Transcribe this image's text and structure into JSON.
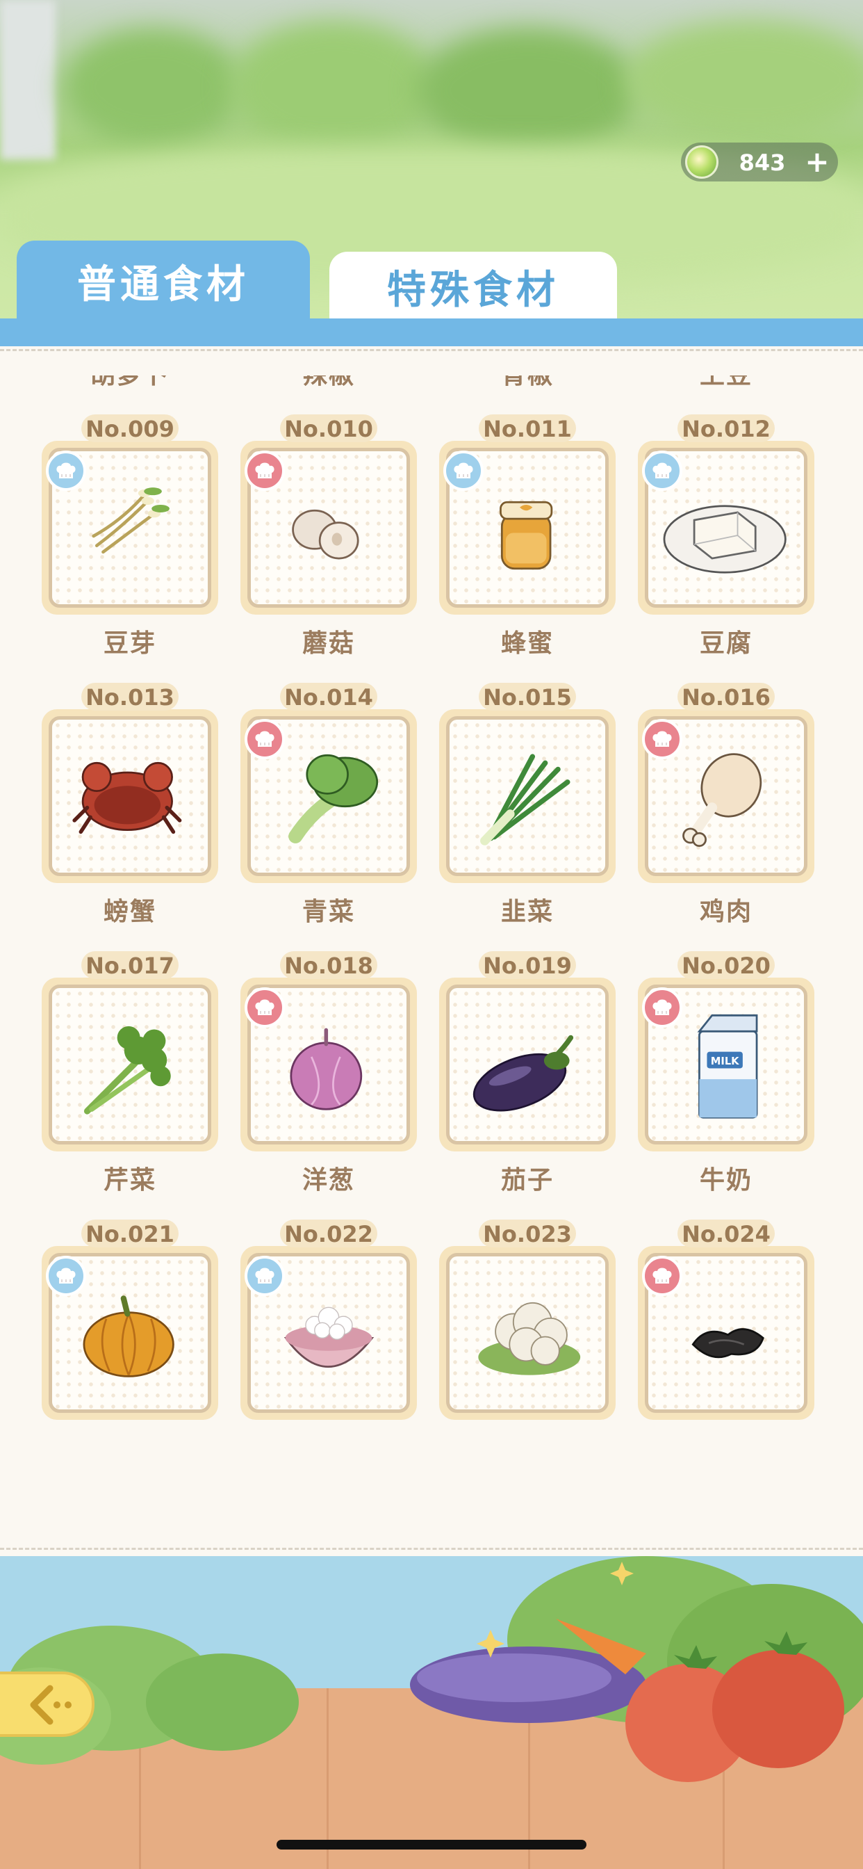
{
  "currency": {
    "icon": "gem-coin-icon",
    "value": "843",
    "add_icon": "plus-icon"
  },
  "tabs": [
    {
      "label": "普通食材",
      "active": true
    },
    {
      "label": "特殊食材",
      "active": false
    }
  ],
  "colors": {
    "tab_active": "#72b8e6",
    "badge_pink": "#e9848e",
    "badge_blue": "#9fd0ec",
    "label_brown": "#9b7c5e"
  },
  "ingredients": [
    {
      "no": "",
      "name": "胡萝卜",
      "badge": "none",
      "icon": "carrot-icon"
    },
    {
      "no": "",
      "name": "辣椒",
      "badge": "none",
      "icon": "chili-pepper-icon"
    },
    {
      "no": "",
      "name": "青椒",
      "badge": "none",
      "icon": "green-pepper-icon"
    },
    {
      "no": "",
      "name": "土豆",
      "badge": "none",
      "icon": "potato-icon"
    },
    {
      "no": "No.009",
      "name": "豆芽",
      "badge": "blue",
      "icon": "bean-sprout-icon"
    },
    {
      "no": "No.010",
      "name": "蘑菇",
      "badge": "pink",
      "icon": "mushroom-icon"
    },
    {
      "no": "No.011",
      "name": "蜂蜜",
      "badge": "blue",
      "icon": "honey-jar-icon"
    },
    {
      "no": "No.012",
      "name": "豆腐",
      "badge": "blue",
      "icon": "tofu-icon"
    },
    {
      "no": "No.013",
      "name": "螃蟹",
      "badge": "none",
      "icon": "crab-icon"
    },
    {
      "no": "No.014",
      "name": "青菜",
      "badge": "pink",
      "icon": "bok-choy-icon"
    },
    {
      "no": "No.015",
      "name": "韭菜",
      "badge": "none",
      "icon": "chive-icon"
    },
    {
      "no": "No.016",
      "name": "鸡肉",
      "badge": "pink",
      "icon": "chicken-leg-icon"
    },
    {
      "no": "No.017",
      "name": "芹菜",
      "badge": "none",
      "icon": "celery-icon"
    },
    {
      "no": "No.018",
      "name": "洋葱",
      "badge": "pink",
      "icon": "onion-icon"
    },
    {
      "no": "No.019",
      "name": "茄子",
      "badge": "none",
      "icon": "eggplant-icon"
    },
    {
      "no": "No.020",
      "name": "牛奶",
      "badge": "pink",
      "icon": "milk-carton-icon"
    },
    {
      "no": "No.021",
      "name": "",
      "badge": "blue",
      "icon": "pumpkin-icon"
    },
    {
      "no": "No.022",
      "name": "",
      "badge": "blue",
      "icon": "rice-bowl-icon"
    },
    {
      "no": "No.023",
      "name": "",
      "badge": "none",
      "icon": "cauliflower-icon"
    },
    {
      "no": "No.024",
      "name": "",
      "badge": "pink",
      "icon": "wood-ear-fungus-icon"
    }
  ],
  "milk_label": "MILK",
  "back_button": {
    "icon": "back-arrow-icon"
  }
}
